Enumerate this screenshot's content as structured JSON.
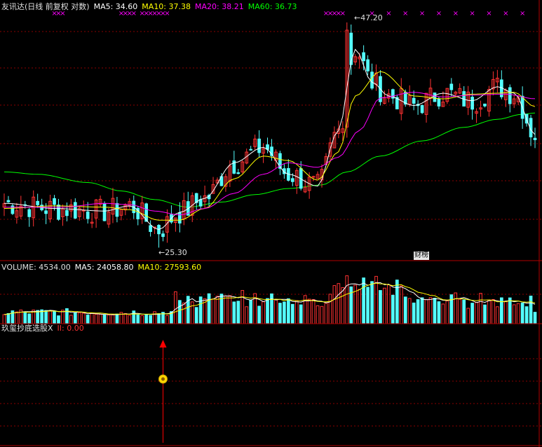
{
  "price_header": {
    "title": "友讯达(日线 前复权 对数)",
    "ma5": "MA5: 34.60",
    "ma10": "MA10: 37.38",
    "ma20": "MA20: 38.21",
    "ma60": "MA60: 36.73"
  },
  "volume_header": {
    "label": "VOLUME: 4534.00",
    "ma5": "MA5: 24058.80",
    "ma10": "MA10: 27593.60"
  },
  "indicator_header": {
    "name": "玖玺抄底选股X",
    "value": "II: 0.00"
  },
  "annotations": {
    "high_price": "47.20",
    "low_price": "25.30",
    "news_badge": "财榜"
  },
  "colors": {
    "up": "#ff3232",
    "down": "#54ffff",
    "ma5": "#ffffff",
    "ma10": "#ffff00",
    "ma20": "#ff00ff",
    "ma60": "#00ff00",
    "grid": "#8b0000",
    "signal": "#ff0000",
    "signal_icon": "#ffd700"
  },
  "chart_data": {
    "type": "candlestick",
    "price_scale": "log",
    "ylim": [
      24.5,
      48.5
    ],
    "x_count": 128,
    "high_point": {
      "index": 82,
      "value": 47.2
    },
    "low_point": {
      "index": 37,
      "value": 25.3
    },
    "ma_series": [
      {
        "name": "MA5",
        "anchors": [
          [
            0,
            28.6
          ],
          [
            12,
            28.2
          ],
          [
            24,
            28.0
          ],
          [
            30,
            28.4
          ],
          [
            37,
            26.6
          ],
          [
            42,
            27.9
          ],
          [
            48,
            29.0
          ],
          [
            55,
            32.0
          ],
          [
            62,
            33.4
          ],
          [
            68,
            31.0
          ],
          [
            75,
            30.0
          ],
          [
            80,
            35.0
          ],
          [
            84,
            43.8
          ],
          [
            88,
            40.0
          ],
          [
            92,
            38.5
          ],
          [
            98,
            37.5
          ],
          [
            105,
            38.8
          ],
          [
            112,
            38.0
          ],
          [
            118,
            39.5
          ],
          [
            122,
            38.8
          ],
          [
            127,
            34.6
          ]
        ]
      },
      {
        "name": "MA10",
        "anchors": [
          [
            0,
            28.2
          ],
          [
            12,
            28.4
          ],
          [
            24,
            28.3
          ],
          [
            30,
            28.1
          ],
          [
            37,
            27.3
          ],
          [
            42,
            27.3
          ],
          [
            48,
            28.2
          ],
          [
            55,
            30.6
          ],
          [
            62,
            32.6
          ],
          [
            68,
            32.2
          ],
          [
            75,
            30.5
          ],
          [
            80,
            33.0
          ],
          [
            84,
            38.5
          ],
          [
            90,
            41.2
          ],
          [
            98,
            38.5
          ],
          [
            105,
            38.2
          ],
          [
            112,
            38.7
          ],
          [
            118,
            38.8
          ],
          [
            122,
            38.9
          ],
          [
            127,
            37.38
          ]
        ]
      },
      {
        "name": "MA20",
        "anchors": [
          [
            0,
            28.3
          ],
          [
            14,
            28.3
          ],
          [
            24,
            28.6
          ],
          [
            30,
            28.5
          ],
          [
            36,
            28.0
          ],
          [
            42,
            27.7
          ],
          [
            48,
            28.2
          ],
          [
            55,
            29.4
          ],
          [
            62,
            31.0
          ],
          [
            68,
            32.0
          ],
          [
            75,
            31.6
          ],
          [
            80,
            32.5
          ],
          [
            85,
            35.0
          ],
          [
            90,
            38.3
          ],
          [
            98,
            38.9
          ],
          [
            105,
            38.4
          ],
          [
            112,
            38.6
          ],
          [
            120,
            38.7
          ],
          [
            127,
            38.21
          ]
        ]
      },
      {
        "name": "MA60",
        "anchors": [
          [
            0,
            31.2
          ],
          [
            8,
            31.0
          ],
          [
            20,
            30.3
          ],
          [
            28,
            29.6
          ],
          [
            36,
            28.9
          ],
          [
            44,
            28.3
          ],
          [
            52,
            28.7
          ],
          [
            60,
            29.3
          ],
          [
            68,
            29.8
          ],
          [
            76,
            30.1
          ],
          [
            82,
            31.2
          ],
          [
            90,
            32.6
          ],
          [
            100,
            34.0
          ],
          [
            110,
            35.3
          ],
          [
            118,
            36.1
          ],
          [
            124,
            36.6
          ],
          [
            127,
            36.73
          ]
        ]
      }
    ],
    "volume": {
      "ylim": [
        0,
        60000
      ],
      "current": 4534.0,
      "ma5": 24058.8,
      "ma10": 27593.6,
      "peak_index": 82
    },
    "indicator": {
      "name": "玖玺抄底选股X",
      "II": 0.0,
      "signal_index": 38
    },
    "top_markers": [
      12,
      13,
      14,
      28,
      29,
      30,
      31,
      33,
      34,
      35,
      36,
      37,
      38,
      39,
      77,
      78,
      79,
      80,
      81,
      88,
      92,
      96,
      100,
      104,
      108,
      112,
      116,
      120,
      124
    ]
  }
}
